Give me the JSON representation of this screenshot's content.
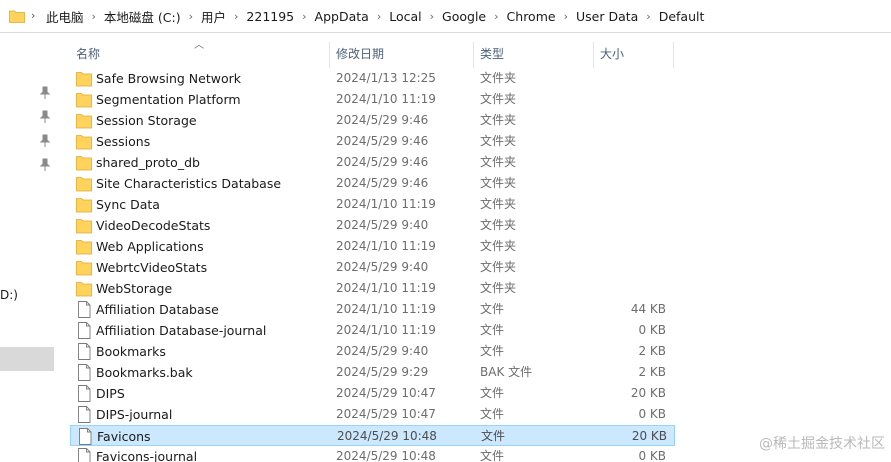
{
  "address_bar": {
    "breadcrumbs": [
      "此电脑",
      "本地磁盘 (C:)",
      "用户",
      "221195",
      "AppData",
      "Local",
      "Google",
      "Chrome",
      "User Data",
      "Default"
    ]
  },
  "nav": {
    "fragment_text": "D:)"
  },
  "columns": {
    "name": "名称",
    "date": "修改日期",
    "type": "类型",
    "size": "大小"
  },
  "files": [
    {
      "name": "Safe Browsing Network",
      "date": "2024/1/13 12:25",
      "type": "文件夹",
      "size": "",
      "kind": "folder"
    },
    {
      "name": "Segmentation Platform",
      "date": "2024/1/10 11:19",
      "type": "文件夹",
      "size": "",
      "kind": "folder"
    },
    {
      "name": "Session Storage",
      "date": "2024/5/29 9:46",
      "type": "文件夹",
      "size": "",
      "kind": "folder"
    },
    {
      "name": "Sessions",
      "date": "2024/5/29 9:46",
      "type": "文件夹",
      "size": "",
      "kind": "folder"
    },
    {
      "name": "shared_proto_db",
      "date": "2024/5/29 9:46",
      "type": "文件夹",
      "size": "",
      "kind": "folder"
    },
    {
      "name": "Site Characteristics Database",
      "date": "2024/5/29 9:46",
      "type": "文件夹",
      "size": "",
      "kind": "folder"
    },
    {
      "name": "Sync Data",
      "date": "2024/1/10 11:19",
      "type": "文件夹",
      "size": "",
      "kind": "folder"
    },
    {
      "name": "VideoDecodeStats",
      "date": "2024/5/29 9:40",
      "type": "文件夹",
      "size": "",
      "kind": "folder"
    },
    {
      "name": "Web Applications",
      "date": "2024/1/10 11:19",
      "type": "文件夹",
      "size": "",
      "kind": "folder"
    },
    {
      "name": "WebrtcVideoStats",
      "date": "2024/5/29 9:40",
      "type": "文件夹",
      "size": "",
      "kind": "folder"
    },
    {
      "name": "WebStorage",
      "date": "2024/1/10 11:19",
      "type": "文件夹",
      "size": "",
      "kind": "folder"
    },
    {
      "name": "Affiliation Database",
      "date": "2024/1/10 11:19",
      "type": "文件",
      "size": "44 KB",
      "kind": "file"
    },
    {
      "name": "Affiliation Database-journal",
      "date": "2024/1/10 11:19",
      "type": "文件",
      "size": "0 KB",
      "kind": "file"
    },
    {
      "name": "Bookmarks",
      "date": "2024/5/29 9:40",
      "type": "文件",
      "size": "2 KB",
      "kind": "file"
    },
    {
      "name": "Bookmarks.bak",
      "date": "2024/5/29 9:29",
      "type": "BAK 文件",
      "size": "2 KB",
      "kind": "file"
    },
    {
      "name": "DIPS",
      "date": "2024/5/29 10:47",
      "type": "文件",
      "size": "20 KB",
      "kind": "file"
    },
    {
      "name": "DIPS-journal",
      "date": "2024/5/29 10:47",
      "type": "文件",
      "size": "0 KB",
      "kind": "file"
    },
    {
      "name": "Favicons",
      "date": "2024/5/29 10:48",
      "type": "文件",
      "size": "20 KB",
      "kind": "file",
      "selected": true
    },
    {
      "name": "Favicons-journal",
      "date": "2024/5/29 10:48",
      "type": "文件",
      "size": "0 KB",
      "kind": "file"
    }
  ],
  "watermark": "@稀土掘金技术社区",
  "colors": {
    "selection_bg": "#cce8ff",
    "selection_border": "#99d1ff",
    "folder_yellow": "#ffd35c",
    "header_text": "#4c607a"
  }
}
